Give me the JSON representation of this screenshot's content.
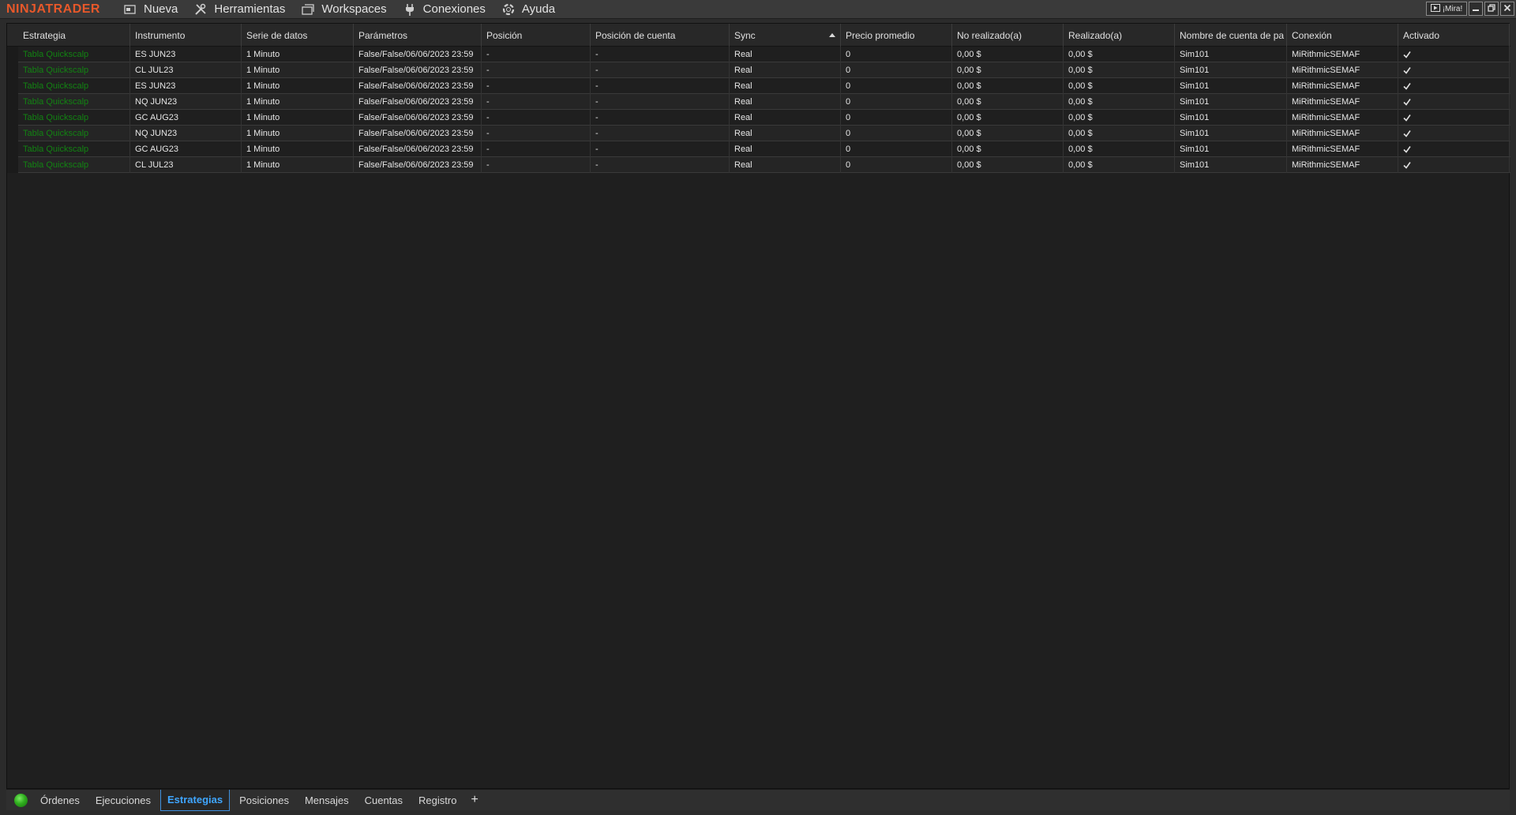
{
  "app": {
    "logo": "NINJATRADER",
    "menu": [
      {
        "label": "Nueva",
        "icon": "new-window-icon"
      },
      {
        "label": "Herramientas",
        "icon": "tools-icon"
      },
      {
        "label": "Workspaces",
        "icon": "workspaces-icon"
      },
      {
        "label": "Conexiones",
        "icon": "plug-icon"
      },
      {
        "label": "Ayuda",
        "icon": "help-lifebuoy-icon"
      }
    ],
    "window_controls": {
      "mira_label": "¡Mira!"
    },
    "accent_color": "#e8582a"
  },
  "grid": {
    "columns": [
      "Estrategia",
      "Instrumento",
      "Serie de datos",
      "Parámetros",
      "Posición",
      "Posición de cuenta",
      "Sync",
      "Precio promedio",
      "No realizado(a)",
      "Realizado(a)",
      "Nombre de cuenta de pa",
      "Conexión",
      "Activado"
    ],
    "sorted_column": "Sync",
    "strategy_text_color": "#128312",
    "rows": [
      {
        "estrategia": "Tabla Quickscalp",
        "instrumento": "ES JUN23",
        "serie": "1 Minuto",
        "parametros": "False/False/06/06/2023 23:59",
        "posicion": "-",
        "posicion_cuenta": "-",
        "sync": "Real",
        "precio": "0",
        "no_realizado": "0,00 $",
        "realizado": "0,00 $",
        "cuenta": "Sim101",
        "conexion": "MiRithmicSEMAF",
        "activado": true
      },
      {
        "estrategia": "Tabla Quickscalp",
        "instrumento": "CL JUL23",
        "serie": "1 Minuto",
        "parametros": "False/False/06/06/2023 23:59",
        "posicion": "-",
        "posicion_cuenta": "-",
        "sync": "Real",
        "precio": "0",
        "no_realizado": "0,00 $",
        "realizado": "0,00 $",
        "cuenta": "Sim101",
        "conexion": "MiRithmicSEMAF",
        "activado": true
      },
      {
        "estrategia": "Tabla Quickscalp",
        "instrumento": "ES JUN23",
        "serie": "1 Minuto",
        "parametros": "False/False/06/06/2023 23:59",
        "posicion": "-",
        "posicion_cuenta": "-",
        "sync": "Real",
        "precio": "0",
        "no_realizado": "0,00 $",
        "realizado": "0,00 $",
        "cuenta": "Sim101",
        "conexion": "MiRithmicSEMAF",
        "activado": true
      },
      {
        "estrategia": "Tabla Quickscalp",
        "instrumento": "NQ JUN23",
        "serie": "1 Minuto",
        "parametros": "False/False/06/06/2023 23:59",
        "posicion": "-",
        "posicion_cuenta": "-",
        "sync": "Real",
        "precio": "0",
        "no_realizado": "0,00 $",
        "realizado": "0,00 $",
        "cuenta": "Sim101",
        "conexion": "MiRithmicSEMAF",
        "activado": true
      },
      {
        "estrategia": "Tabla Quickscalp",
        "instrumento": "GC AUG23",
        "serie": "1 Minuto",
        "parametros": "False/False/06/06/2023 23:59",
        "posicion": "-",
        "posicion_cuenta": "-",
        "sync": "Real",
        "precio": "0",
        "no_realizado": "0,00 $",
        "realizado": "0,00 $",
        "cuenta": "Sim101",
        "conexion": "MiRithmicSEMAF",
        "activado": true
      },
      {
        "estrategia": "Tabla Quickscalp",
        "instrumento": "NQ JUN23",
        "serie": "1 Minuto",
        "parametros": "False/False/06/06/2023 23:59",
        "posicion": "-",
        "posicion_cuenta": "-",
        "sync": "Real",
        "precio": "0",
        "no_realizado": "0,00 $",
        "realizado": "0,00 $",
        "cuenta": "Sim101",
        "conexion": "MiRithmicSEMAF",
        "activado": true
      },
      {
        "estrategia": "Tabla Quickscalp",
        "instrumento": "GC AUG23",
        "serie": "1 Minuto",
        "parametros": "False/False/06/06/2023 23:59",
        "posicion": "-",
        "posicion_cuenta": "-",
        "sync": "Real",
        "precio": "0",
        "no_realizado": "0,00 $",
        "realizado": "0,00 $",
        "cuenta": "Sim101",
        "conexion": "MiRithmicSEMAF",
        "activado": true
      },
      {
        "estrategia": "Tabla Quickscalp",
        "instrumento": "CL JUL23",
        "serie": "1 Minuto",
        "parametros": "False/False/06/06/2023 23:59",
        "posicion": "-",
        "posicion_cuenta": "-",
        "sync": "Real",
        "precio": "0",
        "no_realizado": "0,00 $",
        "realizado": "0,00 $",
        "cuenta": "Sim101",
        "conexion": "MiRithmicSEMAF",
        "activado": true
      }
    ]
  },
  "tabs": {
    "status": "connected",
    "status_color": "#2fae1e",
    "items": [
      "Órdenes",
      "Ejecuciones",
      "Estrategias",
      "Posiciones",
      "Mensajes",
      "Cuentas",
      "Registro"
    ],
    "active": "Estrategias",
    "add_label": "+"
  }
}
